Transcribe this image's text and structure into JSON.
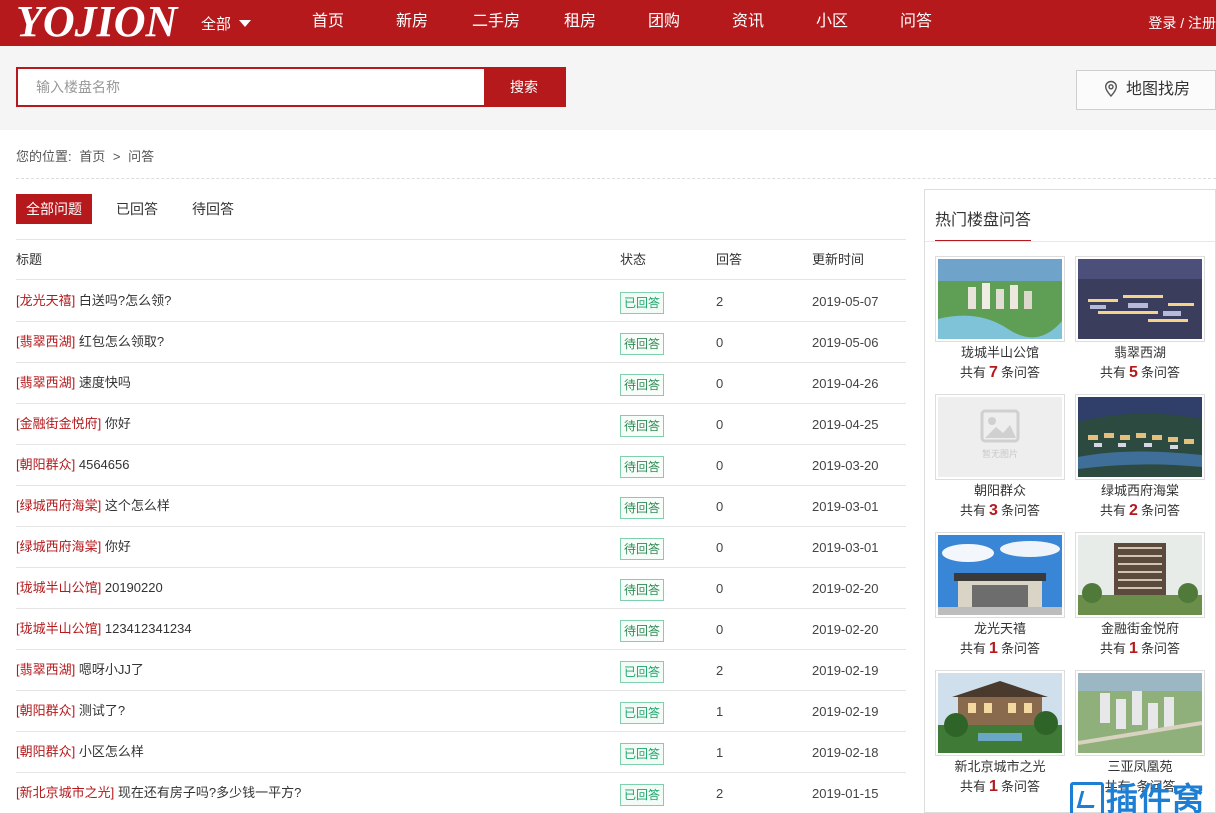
{
  "header": {
    "logo": "YOJION",
    "city_select": "全部",
    "nav": [
      "首页",
      "新房",
      "二手房",
      "租房",
      "团购",
      "资讯",
      "小区",
      "问答"
    ],
    "login": "登录",
    "separator": "/",
    "register": "注册"
  },
  "search": {
    "placeholder": "输入楼盘名称",
    "button": "搜索",
    "map_button": "地图找房"
  },
  "breadcrumb": {
    "prefix": "您的位置:",
    "home": "首页",
    "sep": ">",
    "current": "问答"
  },
  "tabs": [
    "全部问题",
    "已回答",
    "待回答"
  ],
  "table": {
    "headers": [
      "标题",
      "状态",
      "回答",
      "更新时间"
    ],
    "rows": [
      {
        "tag": "[龙光天禧]",
        "title": "白送吗?怎么领?",
        "status": "已回答",
        "answers": "2",
        "date": "2019-05-07"
      },
      {
        "tag": "[翡翠西湖]",
        "title": "红包怎么领取?",
        "status": "待回答",
        "answers": "0",
        "date": "2019-05-06"
      },
      {
        "tag": "[翡翠西湖]",
        "title": "速度快吗",
        "status": "待回答",
        "answers": "0",
        "date": "2019-04-26"
      },
      {
        "tag": "[金融街金悦府]",
        "title": "你好",
        "status": "待回答",
        "answers": "0",
        "date": "2019-04-25"
      },
      {
        "tag": "[朝阳群众]",
        "title": "4564656",
        "status": "待回答",
        "answers": "0",
        "date": "2019-03-20"
      },
      {
        "tag": "[绿城西府海棠]",
        "title": "这个怎么样",
        "status": "待回答",
        "answers": "0",
        "date": "2019-03-01"
      },
      {
        "tag": "[绿城西府海棠]",
        "title": "你好",
        "status": "待回答",
        "answers": "0",
        "date": "2019-03-01"
      },
      {
        "tag": "[珑城半山公馆]",
        "title": "20190220",
        "status": "待回答",
        "answers": "0",
        "date": "2019-02-20"
      },
      {
        "tag": "[珑城半山公馆]",
        "title": "123412341234",
        "status": "待回答",
        "answers": "0",
        "date": "2019-02-20"
      },
      {
        "tag": "[翡翠西湖]",
        "title": "嗯呀小JJ了",
        "status": "已回答",
        "answers": "2",
        "date": "2019-02-19"
      },
      {
        "tag": "[朝阳群众]",
        "title": "测试了?",
        "status": "已回答",
        "answers": "1",
        "date": "2019-02-19"
      },
      {
        "tag": "[朝阳群众]",
        "title": "小区怎么样",
        "status": "已回答",
        "answers": "1",
        "date": "2019-02-18"
      },
      {
        "tag": "[新北京城市之光]",
        "title": "现在还有房子吗?多少钱一平方?",
        "status": "已回答",
        "answers": "2",
        "date": "2019-01-15"
      }
    ]
  },
  "sidebar": {
    "title": "热门楼盘问答",
    "count_prefix": "共有",
    "count_suffix": "条问答",
    "no_image_text": "暂无图片",
    "cards": [
      {
        "name": "珑城半山公馆",
        "count": "7",
        "image": "aerial-river-estate"
      },
      {
        "name": "翡翠西湖",
        "count": "5",
        "image": "night-aerial-estate"
      },
      {
        "name": "朝阳群众",
        "count": "3",
        "image": "placeholder"
      },
      {
        "name": "绿城西府海棠",
        "count": "2",
        "image": "dusk-aerial-villas"
      },
      {
        "name": "龙光天禧",
        "count": "1",
        "image": "pavilion-blue-sky"
      },
      {
        "name": "金融街金悦府",
        "count": "1",
        "image": "tower-building"
      },
      {
        "name": "新北京城市之光",
        "count": "1",
        "image": "villa-garden"
      },
      {
        "name": "三亚凤凰苑",
        "count": "",
        "image": "aerial-towers"
      }
    ]
  },
  "watermark": "插件窝",
  "colors": {
    "brand": "#b5191c",
    "answered": "#1aa56b"
  }
}
